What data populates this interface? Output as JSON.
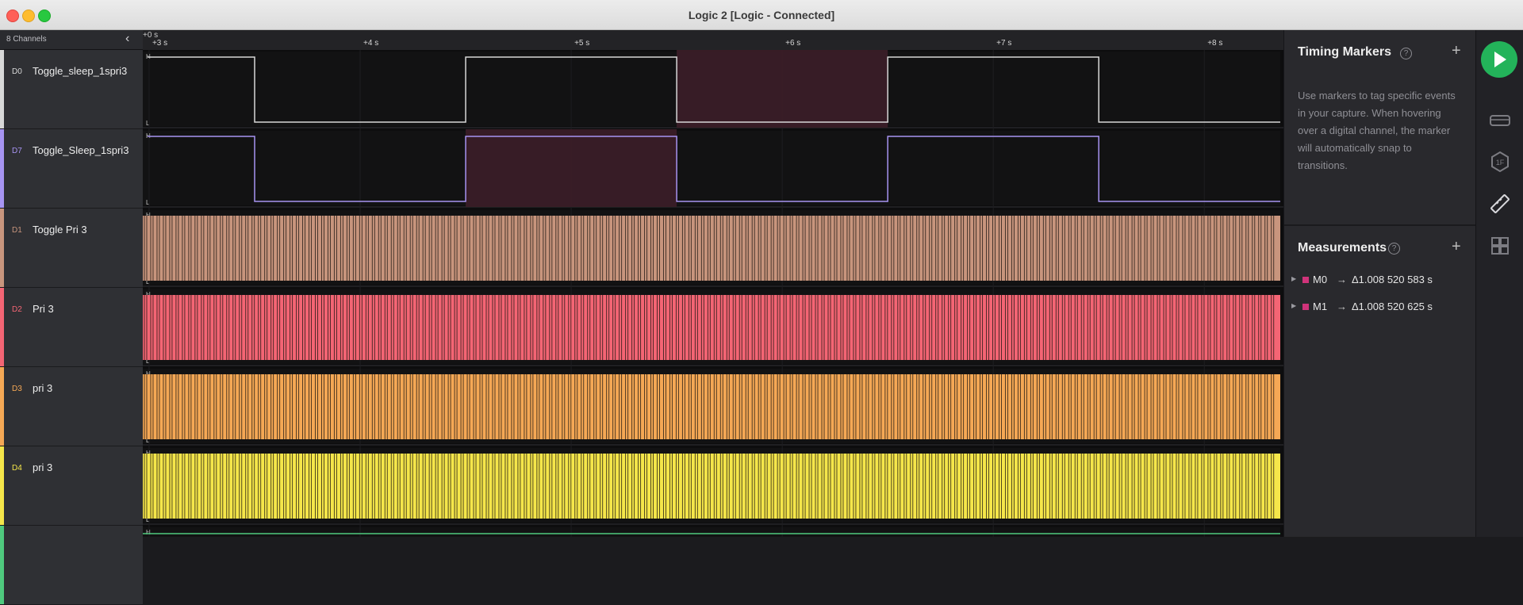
{
  "window": {
    "title": "Logic 2 [Logic - Connected]"
  },
  "sidebar": {
    "channel_count": "8 Channels",
    "channels": [
      {
        "id": "D0",
        "name": "Toggle_sleep_1spri3",
        "color": "#d8d8d8"
      },
      {
        "id": "D7",
        "name": "Toggle_Sleep_1spri3",
        "color": "#a794f2"
      },
      {
        "id": "D1",
        "name": "Toggle Pri 3",
        "color": "#c8957d"
      },
      {
        "id": "D2",
        "name": "Pri 3",
        "color": "#f46574"
      },
      {
        "id": "D3",
        "name": "pri 3",
        "color": "#f5a855"
      },
      {
        "id": "D4",
        "name": "pri 3",
        "color": "#f5e64a"
      },
      {
        "id": "",
        "name": "",
        "color": "#4fc97e"
      }
    ]
  },
  "ruler": {
    "origin": "+0 s",
    "ticks": [
      "+3 s",
      "+4 s",
      "+5 s",
      "+6 s",
      "+7 s",
      "+8 s"
    ]
  },
  "levels": {
    "high": "H",
    "low": "L"
  },
  "timing_markers": {
    "title": "Timing Markers",
    "help": "?",
    "add": "+",
    "description": "Use markers to tag specific events in your capture. When hovering over a digital channel, the marker will automatically snap to transitions."
  },
  "measurements": {
    "title": "Measurements",
    "help": "?",
    "add": "+",
    "items": [
      {
        "name": "M0",
        "arrow": "→",
        "value": "Δ1.008 520 583 s",
        "color": "#d0337a"
      },
      {
        "name": "M1",
        "arrow": "→",
        "value": "Δ1.008 520 625 s",
        "color": "#d0337a"
      }
    ]
  },
  "waveforms": {
    "time_start": 2.97,
    "time_end": 8.36,
    "square_channels": [
      {
        "row": 0,
        "edges": [
          3.5,
          4.5,
          5.5,
          6.5,
          7.5
        ],
        "start_high": true
      },
      {
        "row": 1,
        "edges": [
          3.5,
          4.5,
          5.5,
          6.5,
          7.5
        ],
        "start_high": true
      }
    ],
    "highlights": [
      {
        "row": 0,
        "from": 5.5,
        "to": 6.5,
        "color": "#3a1d27"
      },
      {
        "row": 1,
        "from": 4.5,
        "to": 5.5,
        "color": "#3a1d27"
      }
    ],
    "dense_channels": [
      {
        "row": 2,
        "period": 0.03
      },
      {
        "row": 3,
        "period": 0.03
      },
      {
        "row": 4,
        "period": 0.03
      },
      {
        "row": 5,
        "period": 0.03
      }
    ]
  },
  "rail_icons": [
    "play-icon",
    "analyzers-icon",
    "extensions-icon",
    "ruler-icon",
    "layout-icon"
  ]
}
